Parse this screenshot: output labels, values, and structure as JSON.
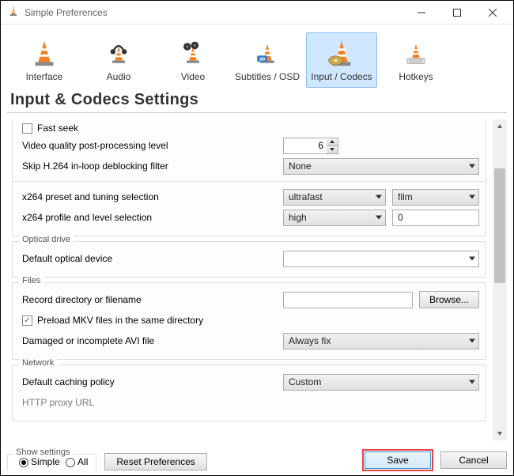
{
  "window": {
    "title": "Simple Preferences"
  },
  "categories": {
    "interface": "Interface",
    "audio": "Audio",
    "video": "Video",
    "subtitles": "Subtitles / OSD",
    "input": "Input / Codecs",
    "hotkeys": "Hotkeys"
  },
  "heading": "Input & Codecs Settings",
  "codecs": {
    "fast_seek": "Fast seek",
    "vq_label": "Video quality post-processing level",
    "vq_value": "6",
    "skip_label": "Skip H.264 in-loop deblocking filter",
    "skip_value": "None",
    "x264_preset_label": "x264 preset and tuning selection",
    "x264_preset_value": "ultrafast",
    "x264_tune_value": "film",
    "x264_profile_label": "x264 profile and level selection",
    "x264_profile_value": "high",
    "x264_level_value": "0"
  },
  "optical": {
    "legend": "Optical drive",
    "default_label": "Default optical device",
    "default_value": ""
  },
  "files": {
    "legend": "Files",
    "record_label": "Record directory or filename",
    "record_value": "",
    "browse": "Browse...",
    "preload": "Preload MKV files in the same directory",
    "avi_label": "Damaged or incomplete AVI file",
    "avi_value": "Always fix"
  },
  "network": {
    "legend": "Network",
    "caching_label": "Default caching policy",
    "caching_value": "Custom",
    "proxy_label": "HTTP proxy URL"
  },
  "footer": {
    "show_legend": "Show settings",
    "simple": "Simple",
    "all": "All",
    "reset": "Reset Preferences",
    "save": "Save",
    "cancel": "Cancel"
  }
}
